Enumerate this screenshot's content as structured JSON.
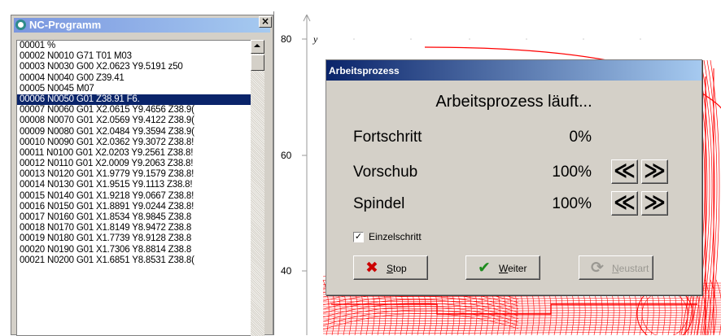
{
  "nc_window": {
    "title": "NC-Programm",
    "close_glyph": "×",
    "selected_index": 5,
    "lines": [
      "00001  %",
      "00002  N0010 G71 T01 M03",
      "00003  N0030 G00 X2.0623 Y9.5191 z50",
      "00004  N0040 G00 Z39.41",
      "00005  N0045 M07",
      "00006  N0050 G01 Z38.91 F6.",
      "00007  N0060 G01 X2.0615 Y9.4656 Z38.9(",
      "00008  N0070 G01 X2.0569 Y9.4122 Z38.9(",
      "00009  N0080 G01 X2.0484 Y9.3594 Z38.9(",
      "00010  N0090 G01 X2.0362 Y9.3072 Z38.8!",
      "00011  N0100 G01 X2.0203 Y9.2561 Z38.8!",
      "00012  N0110 G01 X2.0009 Y9.2063 Z38.8!",
      "00013  N0120 G01 X1.9779 Y9.1579 Z38.8!",
      "00014  N0130 G01 X1.9515 Y9.1113 Z38.8!",
      "00015  N0140 G01 X1.9218 Y9.0667 Z38.8!",
      "00016  N0150 G01 X1.8891 Y9.0244 Z38.8!",
      "00017  N0160 G01 X1.8534 Y8.9845 Z38.8",
      "00018  N0170 G01 X1.8149 Y8.9472 Z38.8",
      "00019  N0180 G01 X1.7739 Y8.9128 Z38.8",
      "00020  N0190 G01 X1.7306 Y8.8814 Z38.8",
      "00021  N0200 G01 X1.6851 Y8.8531 Z38.8("
    ]
  },
  "plot": {
    "axis_label_y": "y",
    "y_ticks": [
      "80",
      "60",
      "40"
    ],
    "path_color": "#ff0000"
  },
  "dialog": {
    "title": "Arbeitsprozess",
    "heading": "Arbeitsprozess läuft...",
    "progress": {
      "label": "Fortschritt",
      "value": "0%"
    },
    "feed": {
      "label": "Vorschub",
      "value": "100%"
    },
    "spindle": {
      "label": "Spindel",
      "value": "100%"
    },
    "decrease_glyph": "≪",
    "increase_glyph": "≫",
    "single_step": {
      "label": "Einzelschritt",
      "checked": true,
      "check_glyph": "✓"
    },
    "buttons": {
      "stop": {
        "label": "Stop",
        "icon": "x-icon",
        "glyph": "✖",
        "color": "#cc0000"
      },
      "continue": {
        "label": "Weiter",
        "icon": "checkmark-icon",
        "glyph": "✔",
        "color": "#1e8c1e"
      },
      "restart": {
        "label": "Neustart",
        "icon": "restart-icon",
        "glyph": "⟳",
        "disabled": true
      }
    }
  }
}
